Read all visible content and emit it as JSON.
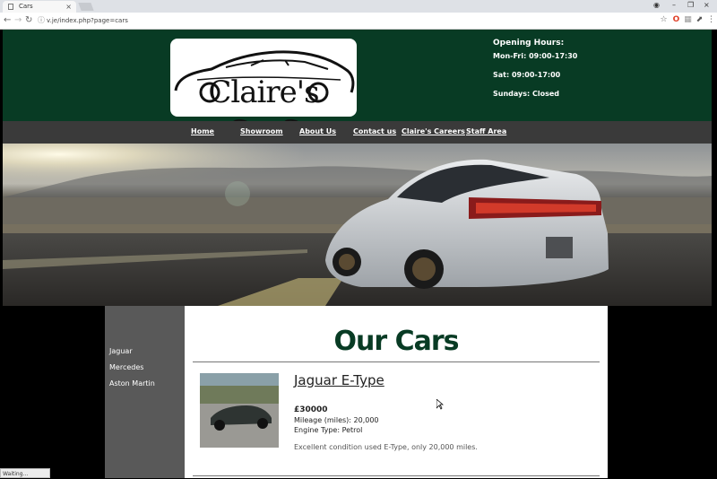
{
  "browser": {
    "tab_title": "Cars",
    "url": "v.je/index.php?page=cars",
    "status": "Waiting..."
  },
  "header": {
    "logo_text": "Claire's CarS",
    "hours": {
      "heading": "Opening Hours:",
      "weekdays": "Mon-Fri: 09:00-17:30",
      "saturday": "Sat: 09:00-17:00",
      "sunday": "Sundays: Closed"
    }
  },
  "nav": {
    "items": [
      {
        "label": "Home"
      },
      {
        "label": "Showroom"
      },
      {
        "label": "About Us"
      },
      {
        "label": "Contact us"
      },
      {
        "label": "Claire's Careers"
      },
      {
        "label": "Staff Area"
      }
    ]
  },
  "sidebar": {
    "items": [
      {
        "label": "Jaguar"
      },
      {
        "label": "Mercedes"
      },
      {
        "label": "Aston Martin"
      }
    ]
  },
  "main": {
    "title": "Our Cars",
    "cars": [
      {
        "name": "Jaguar E-Type",
        "price": "£30000",
        "mileage": "Mileage (miles): 20,000",
        "engine": "Engine Type: Petrol",
        "description": "Excellent condition used E-Type, only 20,000 miles."
      }
    ]
  },
  "colors": {
    "brand_green": "#083b24",
    "nav_grey": "#3a3a3a",
    "sidebar_grey": "#595959"
  }
}
